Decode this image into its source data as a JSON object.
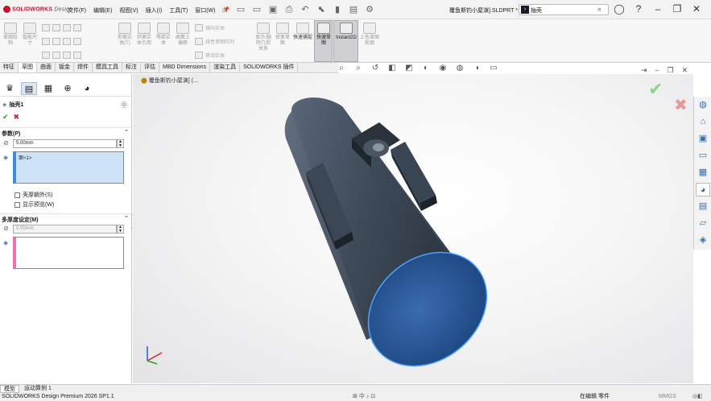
{
  "app": {
    "brand": "SOLIDWORKS",
    "brand_sub": "Design",
    "doc_title": "覆鱼斯钓小屋演].SLDPRT *"
  },
  "menu": [
    "文件(F)",
    "编辑(E)",
    "视图(V)",
    "插入(I)",
    "工具(T)",
    "窗口(W)"
  ],
  "search": {
    "value": "抽壳"
  },
  "ribbon": {
    "buttons": [
      "草图绘制",
      "智能尺寸",
      "剪裁实体(T)",
      "转换实体引用",
      "等距实体",
      "曲面上偏移",
      "显示/删除几何关系",
      "修复草图",
      "快速捕捉",
      "快速草图",
      "Instant2D",
      "上色草图轮廓"
    ],
    "small": [
      "镜向实体",
      "线性草图阵列",
      "移动实体"
    ]
  },
  "tabs": [
    "特征",
    "草图",
    "曲面",
    "钣金",
    "焊件",
    "模具工具",
    "标注",
    "评估",
    "MBD Dimensions",
    "渲染工具",
    "SOLIDWORKS 插件"
  ],
  "panel": {
    "feature_title": "抽壳1",
    "params_label": "参数(P)",
    "thickness": "5.00mm",
    "faces_item": "面<1>",
    "shell_outward": "壳厚朝外(S)",
    "show_preview": "显示预览(W)",
    "multi_label": "多厚度设定(M)",
    "multi_thickness": "5.00mm"
  },
  "viewport": {
    "crumb": "覆鱼斯钓小屋演] (..."
  },
  "bottom_tabs": [
    "模型",
    "运动算例 1"
  ],
  "status": {
    "left": "SOLIDWORKS Design Premium 2026 SP1.1",
    "mid": "在编辑 零件",
    "units": "MMGS"
  },
  "colors": {
    "selected_face": "#1f4f8f",
    "body": "#3a4654",
    "accent": "#c8102e"
  }
}
